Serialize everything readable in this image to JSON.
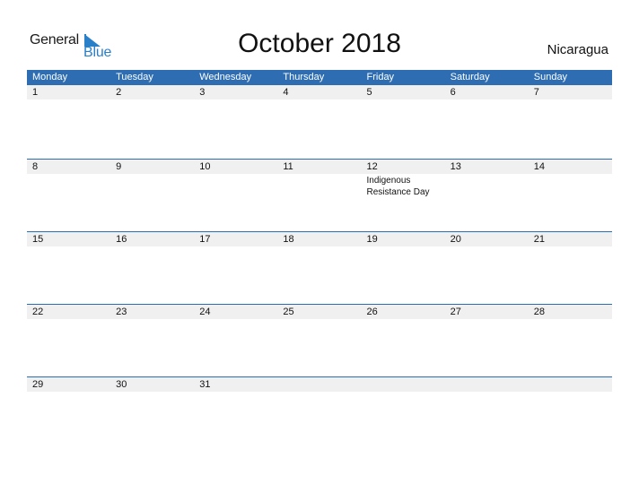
{
  "logo": {
    "line1": "General",
    "line2": "Blue"
  },
  "title": "October 2018",
  "country": "Nicaragua",
  "colors": {
    "header_bg": "#2e6db2",
    "strip_bg": "#f0f0f0",
    "logo_blue": "#2a7fc9"
  },
  "weekdays": [
    "Monday",
    "Tuesday",
    "Wednesday",
    "Thursday",
    "Friday",
    "Saturday",
    "Sunday"
  ],
  "weeks": [
    {
      "days": [
        {
          "n": "1",
          "e": ""
        },
        {
          "n": "2",
          "e": ""
        },
        {
          "n": "3",
          "e": ""
        },
        {
          "n": "4",
          "e": ""
        },
        {
          "n": "5",
          "e": ""
        },
        {
          "n": "6",
          "e": ""
        },
        {
          "n": "7",
          "e": ""
        }
      ]
    },
    {
      "days": [
        {
          "n": "8",
          "e": ""
        },
        {
          "n": "9",
          "e": ""
        },
        {
          "n": "10",
          "e": ""
        },
        {
          "n": "11",
          "e": ""
        },
        {
          "n": "12",
          "e": "Indigenous Resistance Day"
        },
        {
          "n": "13",
          "e": ""
        },
        {
          "n": "14",
          "e": ""
        }
      ]
    },
    {
      "days": [
        {
          "n": "15",
          "e": ""
        },
        {
          "n": "16",
          "e": ""
        },
        {
          "n": "17",
          "e": ""
        },
        {
          "n": "18",
          "e": ""
        },
        {
          "n": "19",
          "e": ""
        },
        {
          "n": "20",
          "e": ""
        },
        {
          "n": "21",
          "e": ""
        }
      ]
    },
    {
      "days": [
        {
          "n": "22",
          "e": ""
        },
        {
          "n": "23",
          "e": ""
        },
        {
          "n": "24",
          "e": ""
        },
        {
          "n": "25",
          "e": ""
        },
        {
          "n": "26",
          "e": ""
        },
        {
          "n": "27",
          "e": ""
        },
        {
          "n": "28",
          "e": ""
        }
      ]
    },
    {
      "days": [
        {
          "n": "29",
          "e": ""
        },
        {
          "n": "30",
          "e": ""
        },
        {
          "n": "31",
          "e": ""
        },
        {
          "n": "",
          "e": ""
        },
        {
          "n": "",
          "e": ""
        },
        {
          "n": "",
          "e": ""
        },
        {
          "n": "",
          "e": ""
        }
      ]
    }
  ]
}
